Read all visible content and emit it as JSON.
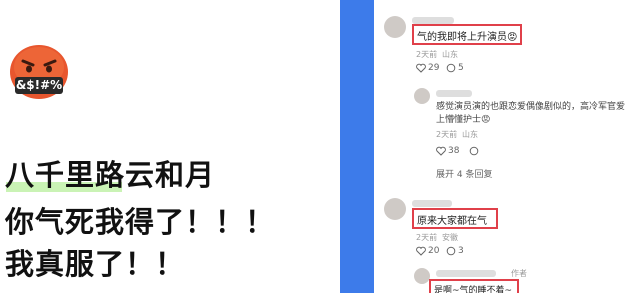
{
  "left": {
    "emoji": {
      "icon": "angry-face-emoji-icon",
      "symbols": "&$!#%"
    },
    "lines": [
      "八千里路云和月",
      "你气死我得了！！！",
      "我真服了！！"
    ],
    "highlight_color": "#b8ef9c"
  },
  "divider_color": "#3d7bea",
  "comments": [
    {
      "text": "气的我即将上升演员😡",
      "time": "2天前",
      "location": "山东",
      "likes": "29",
      "replies": "5"
    },
    {
      "text_line1": "感觉演员演的也跟恋爱偶像剧似的，高冷军官爱",
      "text_line2": "上懵懂护士😡",
      "time": "2天前",
      "location": "山东",
      "likes": "38",
      "replies": ""
    },
    {
      "expand": "展开 4 条回复"
    },
    {
      "text": "原来大家都在气",
      "time": "2天前",
      "location": "安徽",
      "likes": "20",
      "replies": "3"
    },
    {
      "text": "是啊~气的睡不着~",
      "author_tag": "作者"
    }
  ],
  "accent_red": "#e0404a"
}
